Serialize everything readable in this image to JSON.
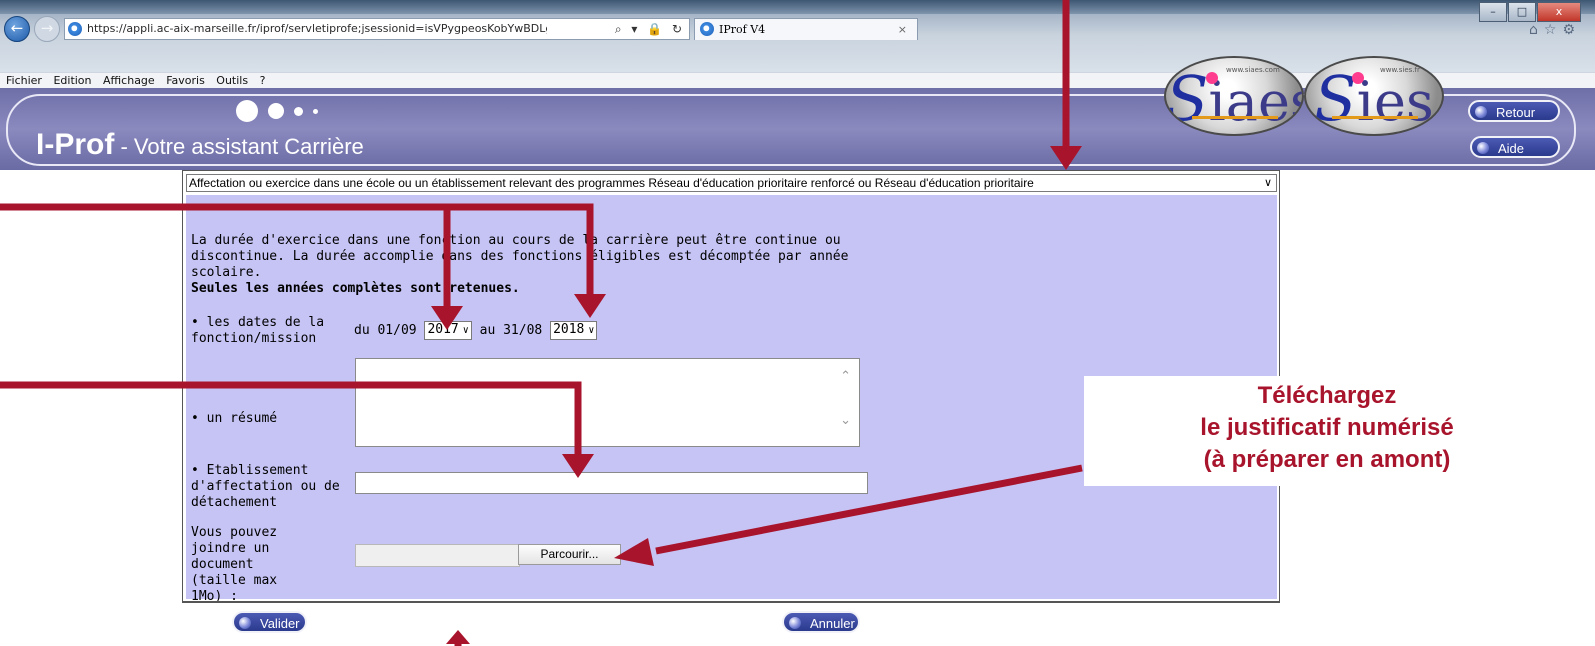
{
  "browser": {
    "address": "https://appli.ac-aix-marseille.fr/iprof/servletiprofe;jsessionid=isVPygpeosKobYwBDLgX(",
    "address_tools": "⌕ ▾ 🔒 ↻",
    "tab_title": "IProf V4",
    "tab_close": "×",
    "right_icons": "⌂☆⚙",
    "window_buttons": [
      "–",
      "□",
      "x"
    ],
    "menu": [
      "Fichier",
      "Edition",
      "Affichage",
      "Favoris",
      "Outils",
      "?"
    ]
  },
  "header": {
    "brand_name": "I-Prof",
    "brand_tagline": " - Votre assistant Carrière",
    "logos": [
      {
        "text": "iaes",
        "initial": "S",
        "small": "www.siaes.com"
      },
      {
        "text": "ies",
        "initial": "S",
        "small": "www.sies.fr"
      }
    ],
    "retour_label": "Retour",
    "aide_label": "Aide"
  },
  "form": {
    "category_select": "Affectation ou exercice dans une école ou un établissement relevant des programmes Réseau d'éducation prioritaire renforcé ou Réseau d'éducation prioritaire",
    "intro": "La durée d'exercice dans une fonction au cours de la carrière peut être continue ou discontinue. La durée accomplie dans des fonctions éligibles est décomptée par année scolaire.",
    "intro_bold": "Seules les années complètes sont retenues.",
    "dates_label": "• les dates de la fonction/mission",
    "from_prefix": "du 01/09",
    "from_year": "2017",
    "to_prefix": "au 31/08",
    "to_year": "2018",
    "resume_label": "• un résumé",
    "resume_value": "",
    "etab_label": "• Etablissement d'affectation ou de détachement",
    "etab_value": "",
    "attach_label": "Vous pouvez joindre un document (taille max 1Mo) :",
    "browse_label": "Parcourir...",
    "valider_label": "Valider",
    "annuler_label": "Annuler"
  },
  "annotation": {
    "line1": "Téléchargez",
    "line2": "le justificatif numérisé",
    "line3": "(à préparer en amont)",
    "color": "#A8142C"
  },
  "colors": {
    "form_background": "#C6C4F4",
    "banner": "#7F7FB7",
    "button": "#2A3A8C"
  }
}
